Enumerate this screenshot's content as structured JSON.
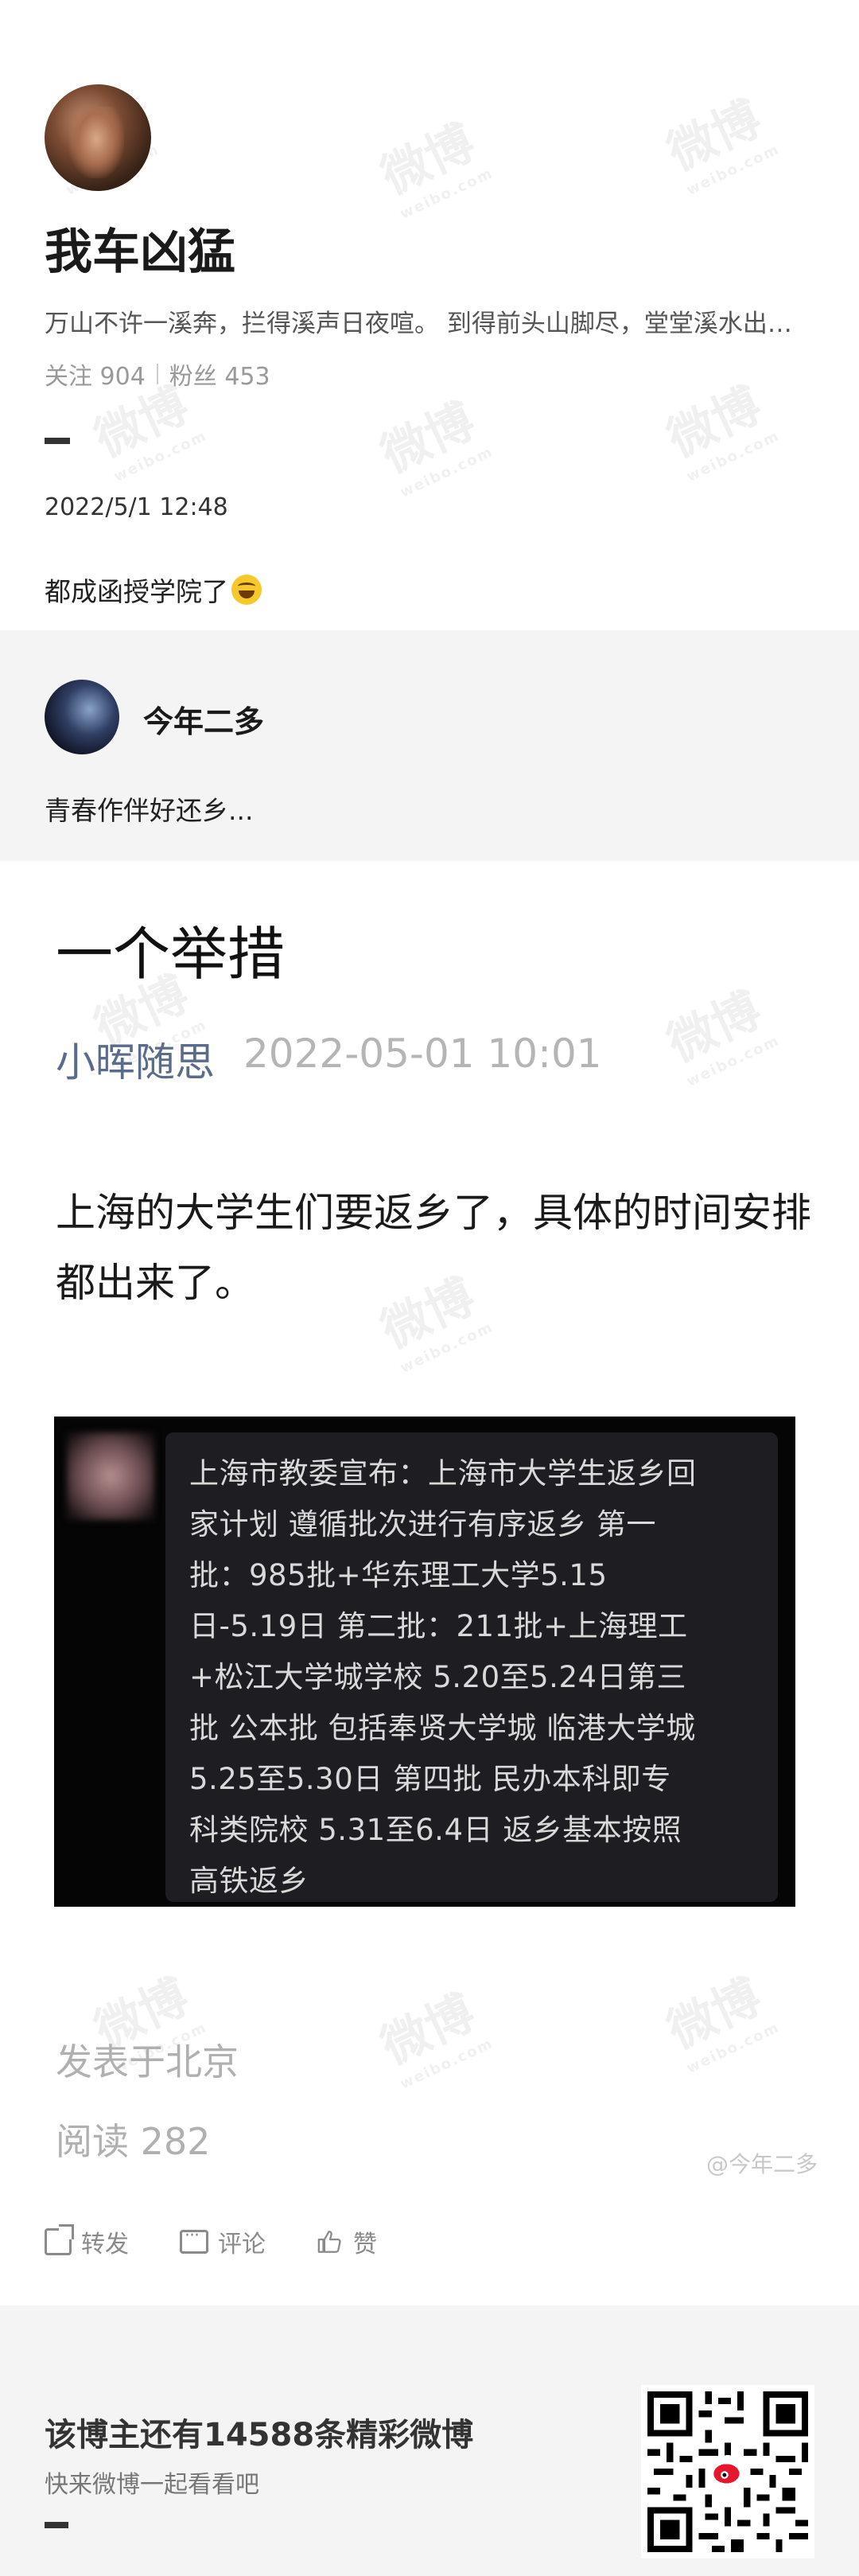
{
  "profile": {
    "name": "我车凶猛",
    "bio": "万山不许一溪奔，拦得溪声日夜喧。 到得前头山脚尽，堂堂溪水出…",
    "follow_label": "关注 904",
    "fans_label": "粉丝 453",
    "date": "2022/5/1 12:48",
    "post_text": "都成函授学院了"
  },
  "quoted_user": {
    "name": "今年二多",
    "text": "青春作伴好还乡..."
  },
  "article": {
    "title": "一个举措",
    "author": "小晖随思",
    "time": "2022-05-01 10:01",
    "body": "上海的大学生们要返乡了，具体的时间安排都出来了。",
    "image_text": "上海市教委宣布：上海市大学生返乡回家计划 遵循批次进行有序返乡 第一批：985批+华东理工大学5.15日-5.19日 第二批：211批+上海理工+松江大学城学校 5.20至5.24日第三批 公本批 包括奉贤大学城 临港大学城 5.25至5.30日 第四批 民办本科即专科类院校 5.31至6.4日 返乡基本按照高铁返乡",
    "location": "发表于北京",
    "reads": "阅读 282",
    "signature": "@今年二多"
  },
  "actions": {
    "share": "转发",
    "comment": "评论",
    "like": "赞"
  },
  "footer": {
    "title": "该博主还有14588条精彩微博",
    "subtitle": "快来微博一起看看吧"
  },
  "watermark": {
    "main": "微博",
    "sub": "weibo.com"
  },
  "colors": {
    "author": "#5a6b8c",
    "muted": "#b0b0b0",
    "band": "#f4f4f4"
  }
}
